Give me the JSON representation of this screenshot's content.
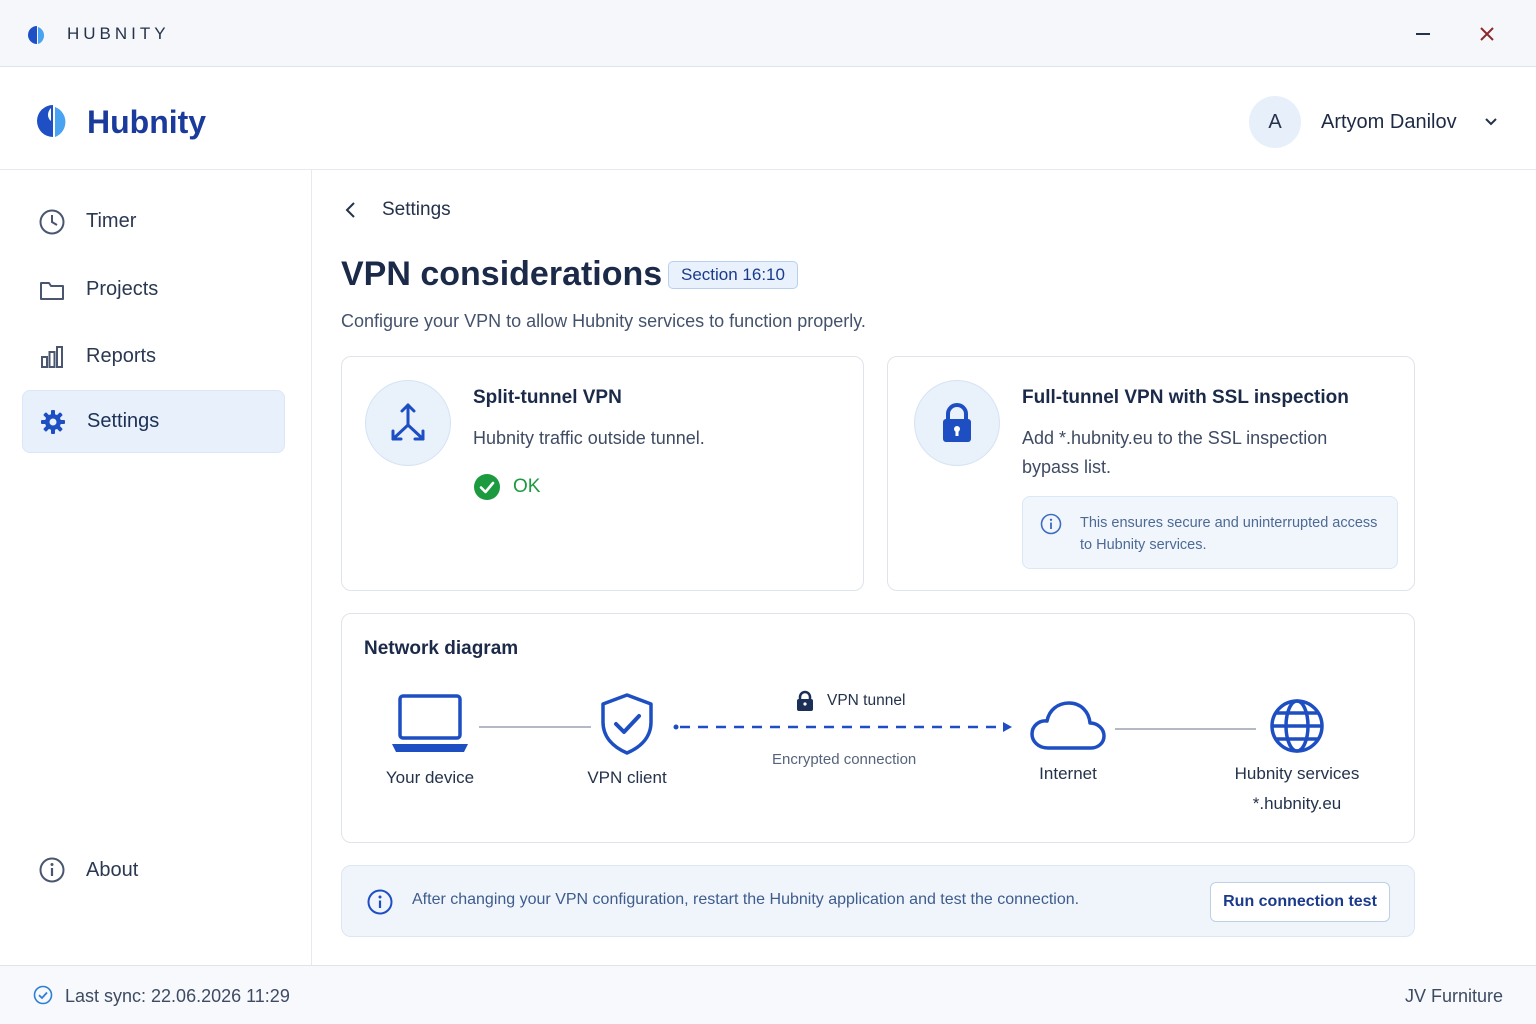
{
  "window": {
    "title": "HUBNITY",
    "icons": {
      "logo": "hubnity-logo-icon",
      "minimize": "minimize-icon",
      "close": "close-icon"
    }
  },
  "header": {
    "brand": "Hubnity",
    "user": {
      "avatar_initial": "A",
      "name": "Artyom Danilov"
    }
  },
  "sidebar": {
    "items": [
      {
        "label": "Timer",
        "icon": "clock-icon",
        "active": false
      },
      {
        "label": "Projects",
        "icon": "folder-icon",
        "active": false
      },
      {
        "label": "Reports",
        "icon": "bar-chart-icon",
        "active": false
      },
      {
        "label": "Settings",
        "icon": "gear-icon",
        "active": true
      }
    ],
    "about": {
      "label": "About",
      "icon": "info-icon"
    }
  },
  "main": {
    "breadcrumb": "Settings",
    "title": "VPN considerations",
    "section_badge": "Section 16:10",
    "description": "Configure your VPN to allow Hubnity services to function properly.",
    "cards": {
      "split": {
        "title": "Split-tunnel VPN",
        "text": "Hubnity traffic outside tunnel.",
        "status": "OK"
      },
      "full": {
        "title": "Full-tunnel VPN with SSL inspection",
        "text": "Add *.hubnity.eu to the SSL inspection bypass list.",
        "note": "This ensures secure and uninterrupted access to Hubnity services."
      }
    },
    "diagram": {
      "title": "Network diagram",
      "nodes": {
        "device": "Your device",
        "vpn_client": "VPN client",
        "internet": "Internet",
        "services": "Hubnity services",
        "services_sub": "*.hubnity.eu"
      },
      "tunnel_label": "VPN tunnel",
      "tunnel_sublabel": "Encrypted connection"
    },
    "info_bar": {
      "text": "After changing your VPN configuration, restart the Hubnity application and test the connection.",
      "button": "Run connection test"
    }
  },
  "status_bar": {
    "sync": "Last sync: 22.06.2026 11:29",
    "org": "JV Furniture"
  },
  "colors": {
    "brand": "#1a3a9c",
    "accent": "#1e4fc2",
    "ok": "#1c9a3f",
    "active_bg": "#e8f0fb"
  }
}
